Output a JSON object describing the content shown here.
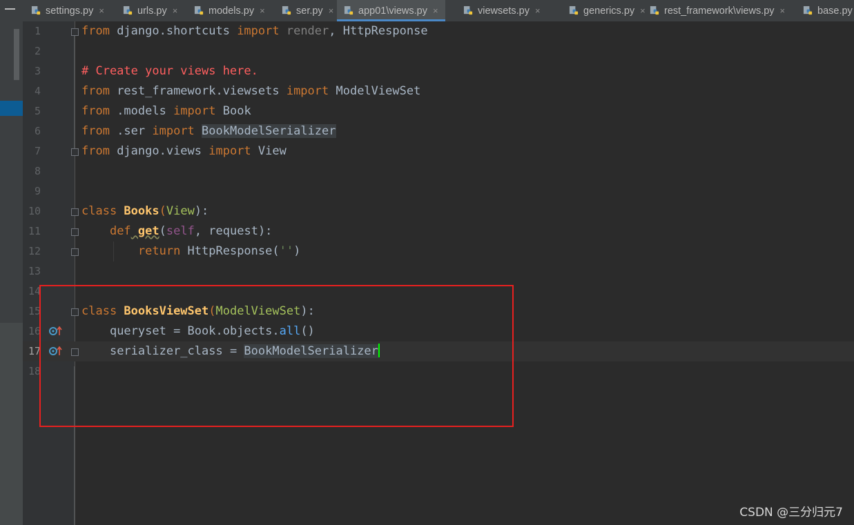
{
  "tabs": [
    {
      "label": "settings.py",
      "active": false
    },
    {
      "label": "urls.py",
      "active": false
    },
    {
      "label": "models.py",
      "active": false
    },
    {
      "label": "ser.py",
      "active": false
    },
    {
      "label": "app01\\views.py",
      "active": true
    },
    {
      "label": "viewsets.py",
      "active": false
    },
    {
      "label": "generics.py",
      "active": false
    },
    {
      "label": "rest_framework\\views.py",
      "active": false
    },
    {
      "label": "base.py",
      "active": false
    }
  ],
  "close_glyph": "×",
  "line_numbers": [
    "1",
    "2",
    "3",
    "4",
    "5",
    "6",
    "7",
    "8",
    "9",
    "10",
    "11",
    "12",
    "13",
    "14",
    "15",
    "16",
    "17",
    "18"
  ],
  "code": {
    "l1": {
      "k1": "from",
      "t1": " django.shortcuts ",
      "k2": "import",
      "t2": " render",
      "t3": ", HttpResponse"
    },
    "l3": {
      "comment": "# Create your views here."
    },
    "l4": {
      "k1": "from",
      "t1": " rest_framework.viewsets ",
      "k2": "import",
      "t2": " ModelViewSet"
    },
    "l5": {
      "k1": "from",
      "t1": " .models ",
      "k2": "import",
      "t2": " Book"
    },
    "l6": {
      "k1": "from",
      "t1": " .ser ",
      "k2": "import",
      "t2": "BookModelSerializer"
    },
    "l7": {
      "k1": "from",
      "t1": " django.views ",
      "k2": "import",
      "t2": " View"
    },
    "l10": {
      "k1": "class",
      "name": " Books",
      "p1": "(",
      "base": "View",
      "p2": "):"
    },
    "l11": {
      "indent": "    ",
      "k1": "def",
      "name": " get",
      "p1": "(",
      "self": "self",
      "t1": ", request):"
    },
    "l12": {
      "indent": "        ",
      "k1": "return",
      "t1": " HttpResponse(",
      "str": "''",
      "t2": ")"
    },
    "l15": {
      "k1": "class",
      "name": " BooksViewSet",
      "p1": "(",
      "base": "ModelViewSet",
      "p2": "):"
    },
    "l16": {
      "indent": "    ",
      "t1": "queryset = Book.objects.",
      "method": "all",
      "t2": "()"
    },
    "l17": {
      "indent": "    ",
      "t1": "serializer_class = ",
      "t2": "BookModelSerializer"
    }
  },
  "watermark": "CSDN @三分归元7",
  "colors": {
    "keyword": "#CC7832",
    "comment": "#FF5F5F",
    "function": "#FFC66D",
    "annotation_box": "#E8201F",
    "cursor": "#00FF00",
    "active_tab_underline": "#4A88C7"
  }
}
